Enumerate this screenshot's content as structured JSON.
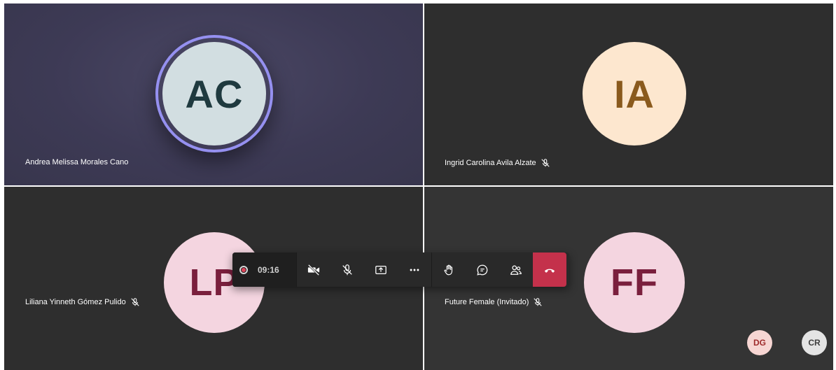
{
  "participants": [
    {
      "name": "Andrea Melissa Morales Cano",
      "initials": "AC",
      "muted": false,
      "speaking": true
    },
    {
      "name": "Ingrid Carolina Avila Alzate",
      "initials": "IA",
      "muted": true,
      "speaking": false
    },
    {
      "name": "Liliana Yinneth Gómez Pulido",
      "initials": "LP",
      "muted": true,
      "speaking": false
    },
    {
      "name": "Future Female (Invitado)",
      "initials": "FF",
      "muted": true,
      "speaking": false
    }
  ],
  "call_controls": {
    "recording": true,
    "timer": "09:16",
    "buttons": [
      "camera-off-icon",
      "mic-off-icon",
      "share-screen-icon",
      "more-icon",
      "raise-hand-icon",
      "chat-icon",
      "participants-icon",
      "hang-up-icon"
    ]
  },
  "overflow_participants": [
    {
      "initials": "DG"
    },
    {
      "initials": "CR"
    }
  ],
  "colors": {
    "speaking_ring": "#9590f0",
    "avatar_ac_bg": "#d2dee1",
    "avatar_ac_fg": "#1f3a3f",
    "avatar_ia_bg": "#fde7cf",
    "avatar_ia_fg": "#8a5a1d",
    "avatar_pink_bg": "#f4d5e0",
    "avatar_pink_fg": "#7a1f3d",
    "hang_up": "#c4314b",
    "recording_dot": "#e0455a"
  }
}
